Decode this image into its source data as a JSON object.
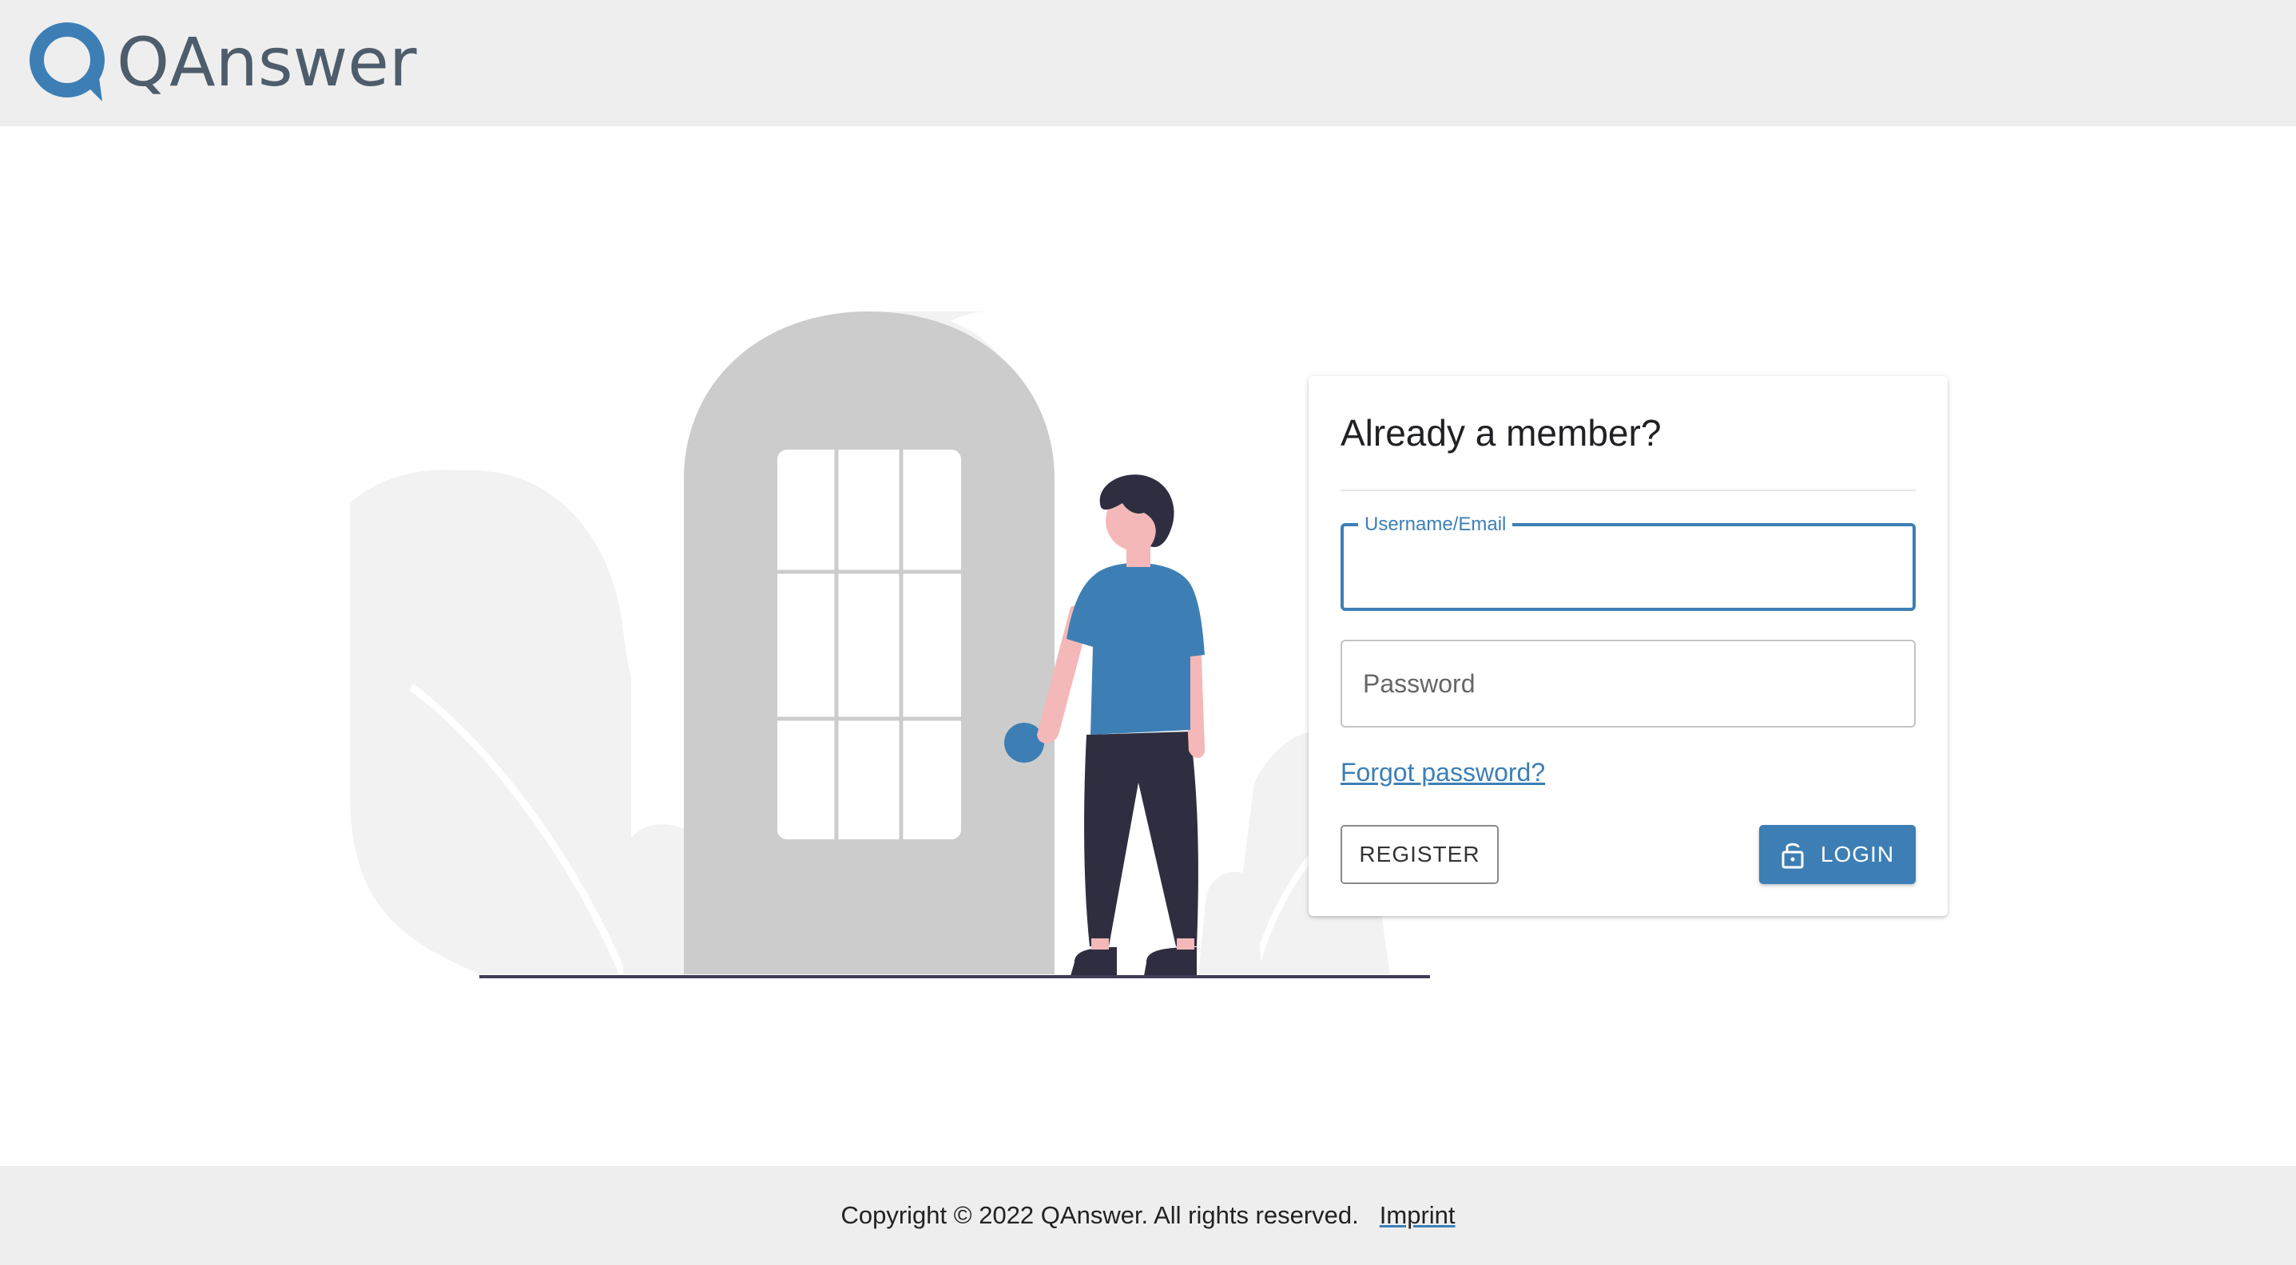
{
  "header": {
    "logo_text": "QAnswer",
    "logo_icon": "speech-bubble-q-icon",
    "brand_color": "#3d7fb5"
  },
  "login": {
    "title": "Already a member?",
    "username_label": "Username/Email",
    "username_value": "",
    "password_placeholder": "Password",
    "password_value": "",
    "forgot_label": "Forgot password?",
    "register_label": "REGISTER",
    "login_label": "LOGIN",
    "login_icon": "lock-open-icon"
  },
  "illustration": {
    "description_icon": "person-at-door-illustration",
    "colors": {
      "door": "#cccccc",
      "plants": "#f2f2f2",
      "shirt": "#3d7fb5",
      "pants": "#2f2e41",
      "skin": "#f5b8b8",
      "ground": "#3f3d56"
    }
  },
  "footer": {
    "copyright": "Copyright © 2022 QAnswer. All rights reserved.",
    "imprint_label": "Imprint"
  }
}
